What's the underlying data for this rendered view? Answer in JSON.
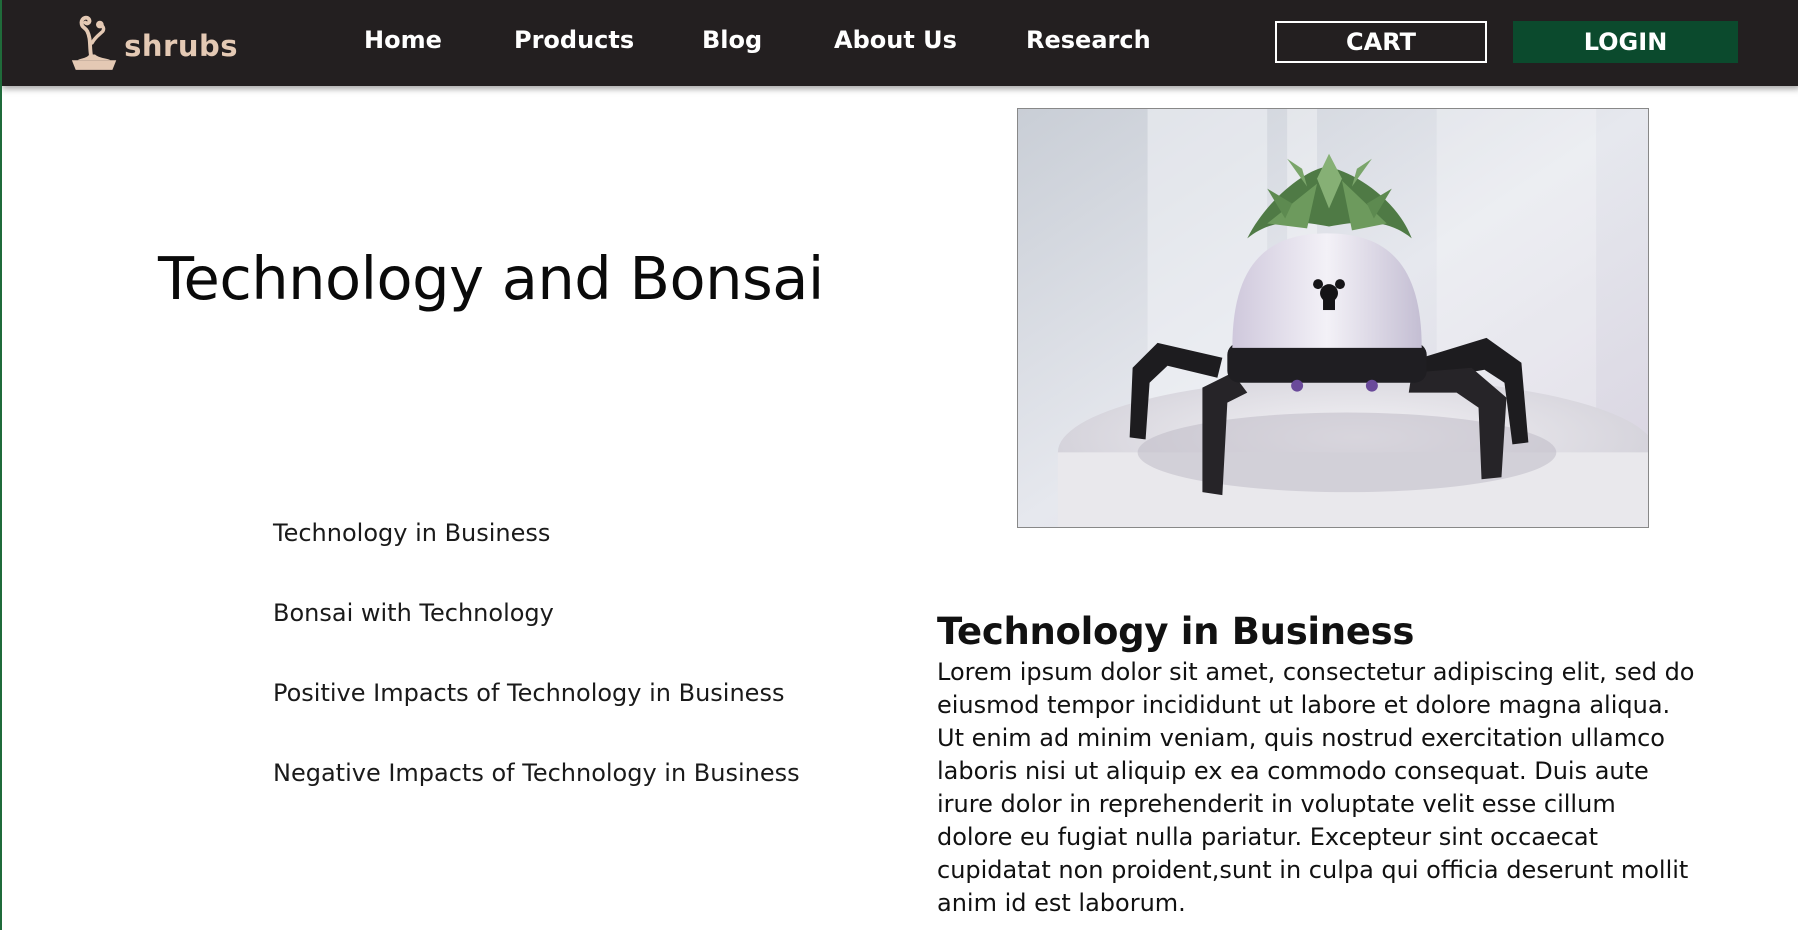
{
  "brand": {
    "name": "shrubs",
    "logo_icon": "bonsai-pot-icon",
    "logo_color": "#e4c9b4"
  },
  "nav": {
    "links": [
      "Home",
      "Products",
      "Blog",
      "About Us",
      "Research"
    ],
    "cart_label": "CART",
    "login_label": "LOGIN",
    "background": "#231f20",
    "login_color": "#0b4a2d"
  },
  "hero": {
    "title": "Technology and Bonsai",
    "image_icon": "robot-planter-image"
  },
  "toc": {
    "items": [
      "Technology in Business",
      "Bonsai with Technology",
      "Positive Impacts of Technology in Business",
      "Negative Impacts of Technology in Business"
    ]
  },
  "article": {
    "heading": "Technology in Business",
    "body": "Lorem ipsum dolor sit amet, consectetur adipiscing elit, sed do eiusmod tempor incididunt ut labore et dolore magna aliqua. Ut enim ad minim veniam, quis nostrud exercitation ullamco laboris nisi ut aliquip ex ea commodo consequat. Duis aute irure dolor in reprehenderit in voluptate velit esse cillum dolore eu fugiat nulla pariatur. Excepteur sint occaecat cupidatat non proident,sunt in culpa qui officia deserunt mollit anim id est laborum."
  }
}
